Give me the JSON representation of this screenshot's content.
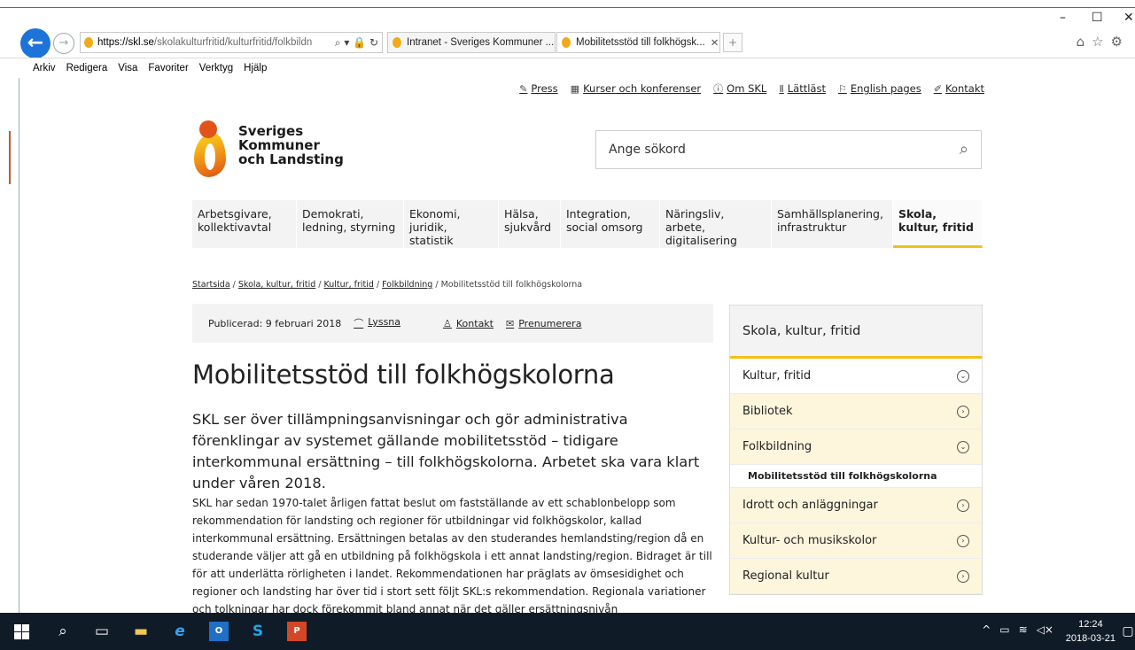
{
  "browser": {
    "url_domain": "https://skl.se",
    "url_path": "/skolakulturfritid/kulturfritid/folkbildn",
    "url_controls": "⌕ ▾ 🔒 ↻",
    "tabs": [
      {
        "label": "Intranet - Sveriges Kommuner ..."
      },
      {
        "label": "Mobilitetsstöd till folkhögsk..."
      }
    ],
    "menu": [
      "Arkiv",
      "Redigera",
      "Visa",
      "Favoriter",
      "Verktyg",
      "Hjälp"
    ]
  },
  "util_links": [
    {
      "icon": "edit-icon",
      "label": "Press"
    },
    {
      "icon": "calendar-icon",
      "label": "Kurser och konferenser"
    },
    {
      "icon": "info-icon",
      "label": "Om SKL"
    },
    {
      "icon": "easy-read-icon",
      "label": "Lättläst"
    },
    {
      "icon": "flag-icon",
      "label": "English pages"
    },
    {
      "icon": "pen-icon",
      "label": "Kontakt"
    }
  ],
  "logo": {
    "line1": "Sveriges",
    "line2": "Kommuner",
    "line3": "och Landsting"
  },
  "search": {
    "placeholder": "Ange sökord"
  },
  "nav": [
    "Arbetsgivare, kollektivavtal",
    "Demokrati, ledning, styrning",
    "Ekonomi, juridik, statistik",
    "Hälsa, sjukvård",
    "Integration, social omsorg",
    "Näringsliv, arbete, digitalisering",
    "Samhällsplanering, infrastruktur",
    "Skola, kultur, fritid"
  ],
  "breadcrumb": {
    "links": [
      "Startsida",
      "Skola, kultur, fritid",
      "Kultur, fritid",
      "Folkbildning"
    ],
    "current": "Mobilitetsstöd till folkhögskolorna"
  },
  "meta": {
    "published": "Publicerad: 9 februari 2018",
    "listen": "Lyssna",
    "contact": "Kontakt",
    "subscribe": "Prenumerera"
  },
  "article": {
    "title": "Mobilitetsstöd till folkhögskolorna",
    "lead": "SKL ser över tillämpningsanvisningar och gör administrativa förenklingar av systemet gällande mobilitetsstöd – tidigare interkommunal ersättning – till folkhögskolorna. Arbetet ska vara klart under våren 2018.",
    "body": "SKL har sedan 1970-talet årligen fattat beslut om fastställande av ett schablonbelopp som rekommendation för landsting och regioner för utbildningar vid folkhögskolor, kallad interkommunal ersättning. Ersättningen betalas av den studerandes hemlandsting/region då en studerande väljer att gå en utbildning på folkhögskola i ett annat landsting/region. Bidraget är till för att underlätta rörligheten i landet. Rekommendationen har präglats av ömsesidighet och regioner och landsting har över tid i stort sett följt SKL:s rekommendation. Regionala variationer och tolkningar har dock förekommit bland annat när det gäller ersättningsnivån"
  },
  "side": {
    "heading": "Skola, kultur, fritid",
    "top": {
      "label": "Kultur, fritid",
      "chevron": "⌄"
    },
    "items_a": [
      {
        "label": "Bibliotek",
        "chevron": "›"
      },
      {
        "label": "Folkbildning",
        "chevron": "⌄"
      }
    ],
    "current": "Mobilitetsstöd till folkhögskolorna",
    "items_b": [
      {
        "label": "Idrott och anläggningar",
        "chevron": "›"
      },
      {
        "label": "Kultur- och musikskolor",
        "chevron": "›"
      },
      {
        "label": "Regional kultur",
        "chevron": "›"
      }
    ]
  },
  "taskbar": {
    "time": "12:24",
    "date": "2018-03-21"
  }
}
